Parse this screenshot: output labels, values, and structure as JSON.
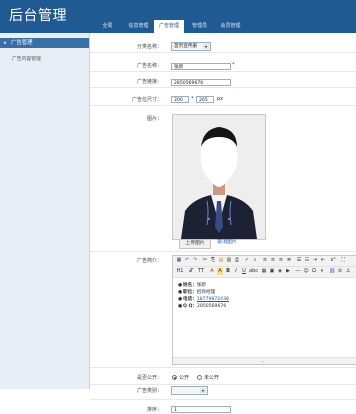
{
  "header": {
    "logo": "后台管理",
    "nav": [
      "全局",
      "信息管理",
      "广告管理",
      "管理员",
      "会员管理"
    ],
    "active_index": 2
  },
  "sidebar": {
    "title": "广告管理",
    "items": [
      "广告内容管理"
    ]
  },
  "form": {
    "category_label": "分类名称：",
    "category_value": "首页宣传册",
    "name_label": "广告名称：",
    "name_value": "张新",
    "phone_label": "广告链接：",
    "phone_value": "2850569676",
    "size_label": "广告位尺寸：",
    "size_w": "200",
    "size_h": "265",
    "size_unit": "px",
    "image_label": "图片：",
    "upload_button": "上传图片",
    "cancel_link": "取消图片",
    "desc_label": "广告简介：",
    "editor_lines": [
      {
        "key": "姓名：",
        "value": "张新"
      },
      {
        "key": "职位：",
        "value": "招商经理"
      },
      {
        "key": "电话：",
        "value": "18779872438"
      },
      {
        "key": "Q Q：",
        "value": "2850569676"
      }
    ],
    "public_label": "是否公开：",
    "public_options": [
      "公开",
      "未公开"
    ],
    "public_selected": 0,
    "type_label": "广告类别：",
    "type_value": "",
    "sort_label": "排序：",
    "sort_value": "1"
  },
  "colors": {
    "header": "#1f5a92",
    "sidebar": "#e8eef6",
    "link": "#1a55b8"
  }
}
